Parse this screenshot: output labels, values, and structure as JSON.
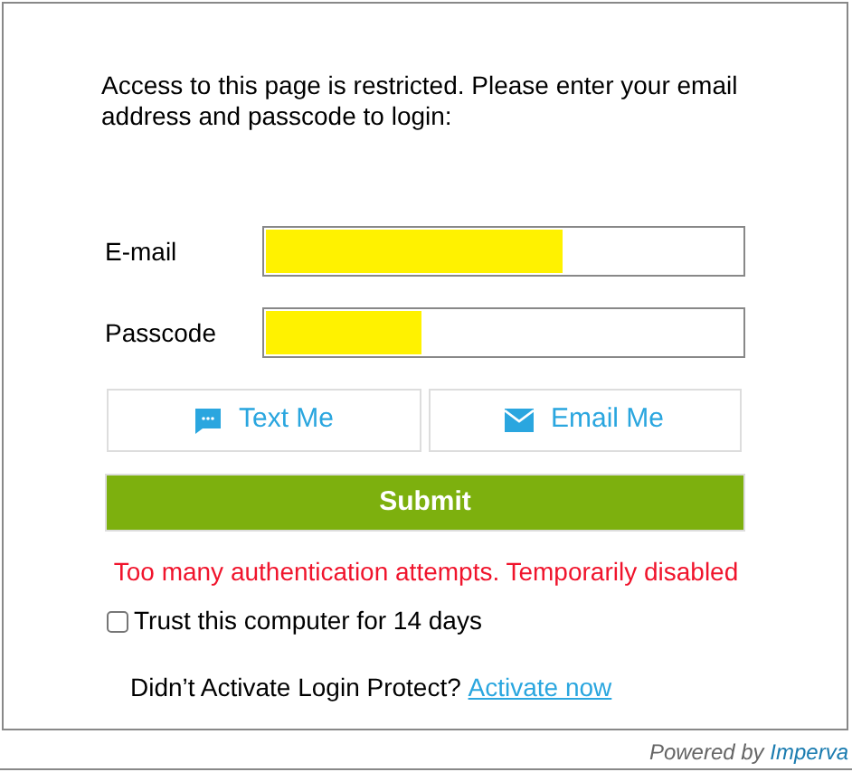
{
  "intro": "Access to this page is restricted. Please enter your email address and passcode to login:",
  "fields": [
    {
      "label": "E-mail",
      "redacted": true
    },
    {
      "label": "Passcode",
      "redacted": true
    }
  ],
  "send_buttons": [
    {
      "kind": "text",
      "label": "Text Me"
    },
    {
      "kind": "email",
      "label": "Email Me"
    }
  ],
  "submit": "Submit",
  "error": "Too many authentication attempts. Temporarily disabled",
  "trust": {
    "label": "Trust this computer for 14 days",
    "checked": false
  },
  "activate": {
    "text": "Didn’t Activate Login Protect?",
    "link": "Activate now"
  },
  "footer": {
    "text": "Powered by",
    "link": "Imperva"
  }
}
